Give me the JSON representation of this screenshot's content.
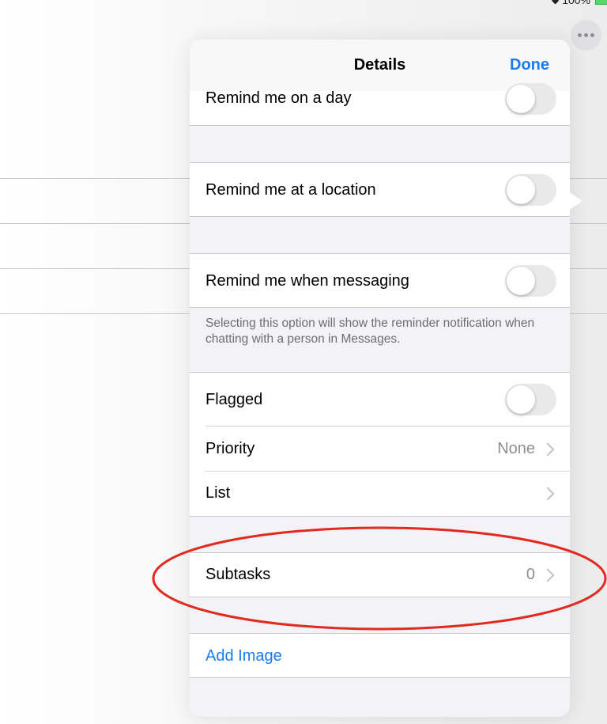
{
  "status": {
    "battery_text": "100%"
  },
  "popover": {
    "title": "Details",
    "done_label": "Done"
  },
  "rows": {
    "remind_day": {
      "label": "Remind me on a day",
      "toggle": false
    },
    "remind_location": {
      "label": "Remind me at a location",
      "toggle": false
    },
    "remind_messaging": {
      "label": "Remind me when messaging",
      "toggle": false
    },
    "messaging_footnote": "Selecting this option will show the reminder notification when chatting with a person in Messages.",
    "flagged": {
      "label": "Flagged",
      "toggle": false
    },
    "priority": {
      "label": "Priority",
      "value": "None"
    },
    "list": {
      "label": "List",
      "value": ""
    },
    "subtasks": {
      "label": "Subtasks",
      "value": "0"
    },
    "add_image": {
      "label": "Add Image"
    }
  },
  "colors": {
    "accent": "#1a7cf1",
    "annotation": "#e2291f",
    "toggle_off": "#e9e9ea"
  },
  "icons": [
    "more-icon",
    "wifi-icon",
    "battery-icon",
    "chevron-right-icon"
  ]
}
